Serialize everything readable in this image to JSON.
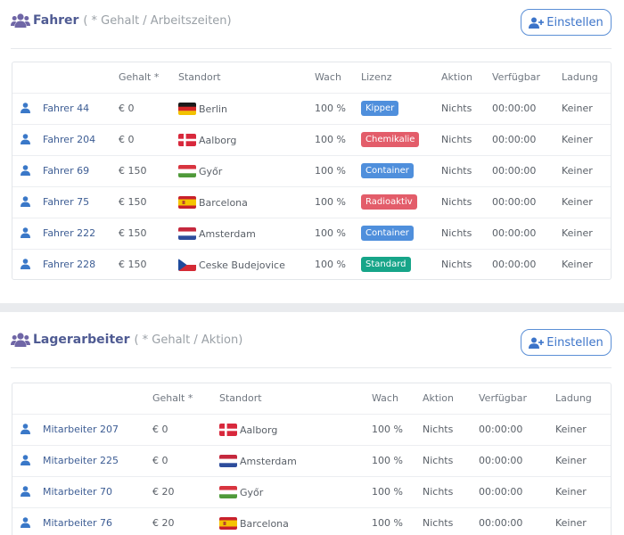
{
  "drivers": {
    "title": "Fahrer",
    "subtitle": "( * Gehalt / Arbeitszeiten)",
    "button_label": "Einstellen",
    "columns": [
      "",
      "",
      "Gehalt *",
      "Standort",
      "Wach",
      "Lizenz",
      "Aktion",
      "Verfügbar",
      "Ladung"
    ],
    "rows": [
      {
        "name": "Fahrer 44",
        "salary": "€ 0",
        "flag": "de",
        "location": "Berlin",
        "awake": "100 %",
        "license": "Kipper",
        "license_color": "#4f8fdc",
        "action": "Nichts",
        "available": "00:00:00",
        "load": "Keiner"
      },
      {
        "name": "Fahrer 204",
        "salary": "€ 0",
        "flag": "dk",
        "location": "Aalborg",
        "awake": "100 %",
        "license": "Chemikalie",
        "license_color": "#e35d6a",
        "action": "Nichts",
        "available": "00:00:00",
        "load": "Keiner"
      },
      {
        "name": "Fahrer 69",
        "salary": "€ 150",
        "flag": "hu",
        "location": "Győr",
        "awake": "100 %",
        "license": "Container",
        "license_color": "#4f8fdc",
        "action": "Nichts",
        "available": "00:00:00",
        "load": "Keiner"
      },
      {
        "name": "Fahrer 75",
        "salary": "€ 150",
        "flag": "es",
        "location": "Barcelona",
        "awake": "100 %",
        "license": "Radioaktiv",
        "license_color": "#e35d6a",
        "action": "Nichts",
        "available": "00:00:00",
        "load": "Keiner"
      },
      {
        "name": "Fahrer 222",
        "salary": "€ 150",
        "flag": "nl",
        "location": "Amsterdam",
        "awake": "100 %",
        "license": "Container",
        "license_color": "#4f8fdc",
        "action": "Nichts",
        "available": "00:00:00",
        "load": "Keiner"
      },
      {
        "name": "Fahrer 228",
        "salary": "€ 150",
        "flag": "cz",
        "location": "Ceske Budejovice",
        "awake": "100 %",
        "license": "Standard",
        "license_color": "#17a589",
        "action": "Nichts",
        "available": "00:00:00",
        "load": "Keiner"
      }
    ]
  },
  "workers": {
    "title": "Lagerarbeiter",
    "subtitle": "( * Gehalt / Aktion)",
    "button_label": "Einstellen",
    "columns": [
      "",
      "",
      "Gehalt *",
      "Standort",
      "Wach",
      "Aktion",
      "Verfügbar",
      "Ladung"
    ],
    "rows": [
      {
        "name": "Mitarbeiter 207",
        "salary": "€ 0",
        "flag": "dk",
        "location": "Aalborg",
        "awake": "100 %",
        "action": "Nichts",
        "available": "00:00:00",
        "load": "Keiner"
      },
      {
        "name": "Mitarbeiter 225",
        "salary": "€ 0",
        "flag": "nl",
        "location": "Amsterdam",
        "awake": "100 %",
        "action": "Nichts",
        "available": "00:00:00",
        "load": "Keiner"
      },
      {
        "name": "Mitarbeiter 70",
        "salary": "€ 20",
        "flag": "hu",
        "location": "Győr",
        "awake": "100 %",
        "action": "Nichts",
        "available": "00:00:00",
        "load": "Keiner"
      },
      {
        "name": "Mitarbeiter 76",
        "salary": "€ 20",
        "flag": "es",
        "location": "Barcelona",
        "awake": "100 %",
        "action": "Nichts",
        "available": "00:00:00",
        "load": "Keiner"
      }
    ]
  },
  "icons": {
    "header": "users-icon",
    "button": "user-plus-icon",
    "row": "user-icon"
  },
  "colors": {
    "title": "#4f5b93",
    "link": "#3d5d94",
    "accent": "#3c74c9"
  }
}
